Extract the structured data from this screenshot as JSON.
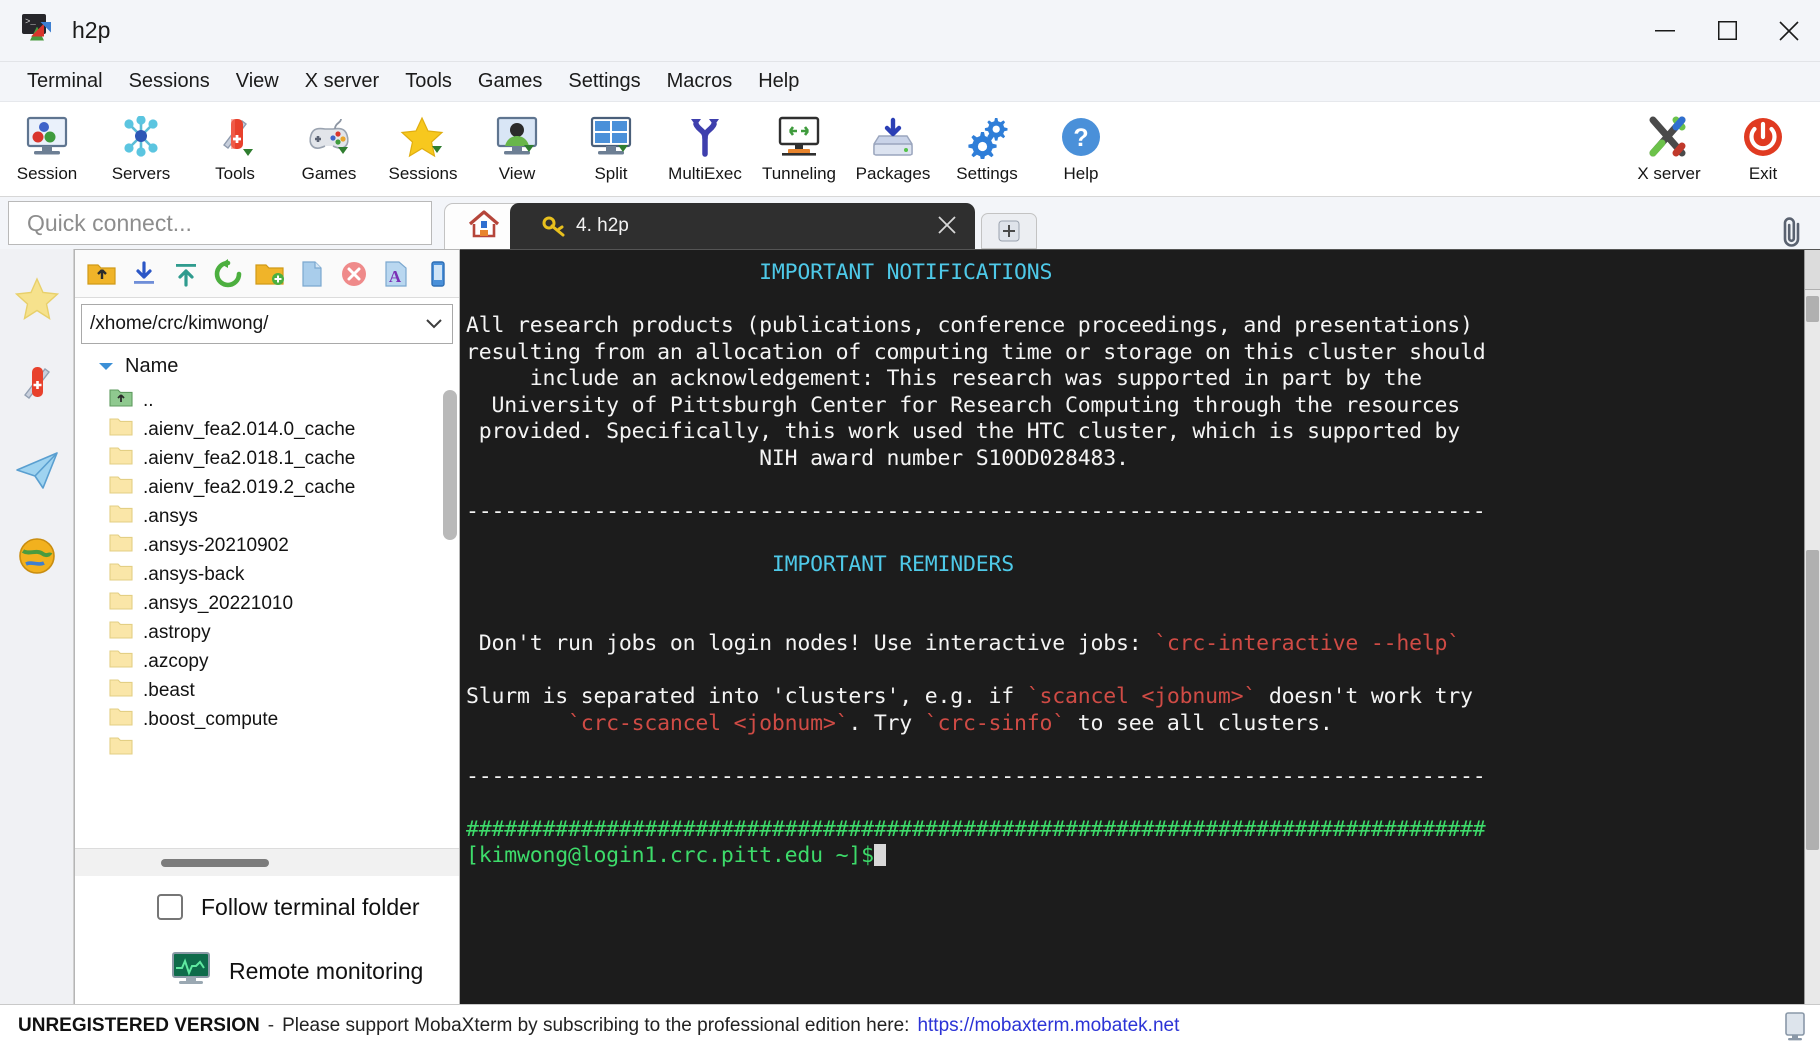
{
  "window": {
    "title": "h2p",
    "app_icon": "mobaxterm-icon",
    "minimize_label": "minimize",
    "maximize_label": "maximize",
    "close_label": "close"
  },
  "menubar": {
    "items": [
      {
        "label": "Terminal",
        "name": "menu-terminal"
      },
      {
        "label": "Sessions",
        "name": "menu-sessions"
      },
      {
        "label": "View",
        "name": "menu-view"
      },
      {
        "label": "X server",
        "name": "menu-x-server"
      },
      {
        "label": "Tools",
        "name": "menu-tools"
      },
      {
        "label": "Games",
        "name": "menu-games"
      },
      {
        "label": "Settings",
        "name": "menu-settings"
      },
      {
        "label": "Macros",
        "name": "menu-macros"
      },
      {
        "label": "Help",
        "name": "menu-help"
      }
    ]
  },
  "toolbar": {
    "buttons": [
      {
        "label": "Session",
        "icon": "session-icon"
      },
      {
        "label": "Servers",
        "icon": "servers-icon"
      },
      {
        "label": "Tools",
        "icon": "tools-icon"
      },
      {
        "label": "Games",
        "icon": "games-icon"
      },
      {
        "label": "Sessions",
        "icon": "sessions-star-icon"
      },
      {
        "label": "View",
        "icon": "view-icon"
      },
      {
        "label": "Split",
        "icon": "split-icon"
      },
      {
        "label": "MultiExec",
        "icon": "multiexec-icon"
      },
      {
        "label": "Tunneling",
        "icon": "tunneling-icon"
      },
      {
        "label": "Packages",
        "icon": "packages-icon"
      },
      {
        "label": "Settings",
        "icon": "settings-gear-icon"
      },
      {
        "label": "Help",
        "icon": "help-icon"
      }
    ],
    "right_buttons": [
      {
        "label": "X server",
        "icon": "x-server-icon"
      },
      {
        "label": "Exit",
        "icon": "exit-power-icon"
      }
    ]
  },
  "quick_connect": {
    "placeholder": "Quick connect...",
    "value": ""
  },
  "tabs": {
    "home_tab_icon": "home-icon",
    "terminal_tab": {
      "label": "4. h2p",
      "icon": "key-icon",
      "close_glyph": "×"
    },
    "add_tab_glyph": "➕",
    "clip_icon": "paperclip-icon"
  },
  "sidebar_rail": {
    "items": [
      {
        "name": "sidebar-sessions-star",
        "icon": "star-icon"
      },
      {
        "name": "sidebar-tools",
        "icon": "tools-icon"
      },
      {
        "name": "sidebar-macros",
        "icon": "paper-plane-icon"
      },
      {
        "name": "sidebar-sftp-globe",
        "icon": "globe-icon"
      }
    ]
  },
  "sftp": {
    "toolbar_icons": [
      {
        "name": "go-up-folder-button",
        "icon": "folder-up-icon"
      },
      {
        "name": "download-button",
        "icon": "download-arrow-icon"
      },
      {
        "name": "upload-button",
        "icon": "upload-arrow-icon"
      },
      {
        "name": "refresh-button",
        "icon": "refresh-icon"
      },
      {
        "name": "new-folder-button",
        "icon": "new-folder-icon"
      },
      {
        "name": "new-file-button",
        "icon": "new-file-icon"
      },
      {
        "name": "delete-button",
        "icon": "delete-circle-icon"
      },
      {
        "name": "text-mode-button",
        "icon": "font-a-icon"
      },
      {
        "name": "panel-toggle-button",
        "icon": "panel-toggle-icon"
      }
    ],
    "path": "/xhome/crc/kimwong/",
    "path_caret_glyph": "⌄",
    "column_header": "Name",
    "sort_caret_glyph": "▼",
    "files": [
      {
        "name": "..",
        "type": "parent"
      },
      {
        "name": ".aienv_fea2.014.0_cache",
        "type": "folder"
      },
      {
        "name": ".aienv_fea2.018.1_cache",
        "type": "folder"
      },
      {
        "name": ".aienv_fea2.019.2_cache",
        "type": "folder"
      },
      {
        "name": ".ansys",
        "type": "folder"
      },
      {
        "name": ".ansys-20210902",
        "type": "folder"
      },
      {
        "name": ".ansys-back",
        "type": "folder"
      },
      {
        "name": ".ansys_20221010",
        "type": "folder"
      },
      {
        "name": ".astropy",
        "type": "folder"
      },
      {
        "name": ".azcopy",
        "type": "folder"
      },
      {
        "name": ".beast",
        "type": "folder"
      },
      {
        "name": ".boost_compute",
        "type": "folder"
      }
    ],
    "follow_terminal_folder": {
      "label": "Follow terminal folder",
      "checked": false
    },
    "remote_monitoring": {
      "label": "Remote monitoring",
      "icon": "monitor-graph-icon"
    }
  },
  "terminal": {
    "lines": [
      {
        "segments": [
          {
            "text": "                       ",
            "color": "white"
          },
          {
            "text": "IMPORTANT NOTIFICATIONS",
            "color": "cyan"
          }
        ]
      },
      {
        "segments": [
          {
            "text": "",
            "color": "white"
          }
        ]
      },
      {
        "segments": [
          {
            "text": "All research products (publications, conference proceedings, and presentations)",
            "color": "white"
          }
        ]
      },
      {
        "segments": [
          {
            "text": "resulting from an allocation of computing time or storage on this cluster should",
            "color": "white"
          }
        ]
      },
      {
        "segments": [
          {
            "text": "     include an acknowledgement: This research was supported in part by the",
            "color": "white"
          }
        ]
      },
      {
        "segments": [
          {
            "text": "  University of Pittsburgh Center for Research Computing through the resources",
            "color": "white"
          }
        ]
      },
      {
        "segments": [
          {
            "text": " provided. Specifically, this work used the HTC cluster, which is supported by",
            "color": "white"
          }
        ]
      },
      {
        "segments": [
          {
            "text": "                       NIH award number S10OD028483.",
            "color": "white"
          }
        ]
      },
      {
        "segments": [
          {
            "text": "",
            "color": "white"
          }
        ]
      },
      {
        "segments": [
          {
            "text": "--------------------------------------------------------------------------------",
            "color": "white"
          }
        ]
      },
      {
        "segments": [
          {
            "text": "",
            "color": "white"
          }
        ]
      },
      {
        "segments": [
          {
            "text": "                        ",
            "color": "white"
          },
          {
            "text": "IMPORTANT REMINDERS",
            "color": "cyan"
          }
        ]
      },
      {
        "segments": [
          {
            "text": "",
            "color": "white"
          }
        ]
      },
      {
        "segments": [
          {
            "text": "",
            "color": "white"
          }
        ]
      },
      {
        "segments": [
          {
            "text": " Don't run jobs on login nodes! Use interactive jobs: ",
            "color": "white"
          },
          {
            "text": "`crc-interactive --help`",
            "color": "red"
          }
        ]
      },
      {
        "segments": [
          {
            "text": "",
            "color": "white"
          }
        ]
      },
      {
        "segments": [
          {
            "text": "Slurm is separated into 'clusters', e.g. if ",
            "color": "white"
          },
          {
            "text": "`scancel <jobnum>`",
            "color": "red"
          },
          {
            "text": " doesn't work try",
            "color": "white"
          }
        ]
      },
      {
        "segments": [
          {
            "text": "        ",
            "color": "white"
          },
          {
            "text": "`crc-scancel <jobnum>`",
            "color": "red"
          },
          {
            "text": ". Try ",
            "color": "white"
          },
          {
            "text": "`crc-sinfo`",
            "color": "red"
          },
          {
            "text": " to see all clusters.",
            "color": "white"
          }
        ]
      },
      {
        "segments": [
          {
            "text": "",
            "color": "white"
          }
        ]
      },
      {
        "segments": [
          {
            "text": "--------------------------------------------------------------------------------",
            "color": "white"
          }
        ]
      },
      {
        "segments": [
          {
            "text": "",
            "color": "white"
          }
        ]
      },
      {
        "segments": [
          {
            "text": "################################################################################",
            "color": "green"
          }
        ]
      },
      {
        "segments": [
          {
            "text": "[kimwong@login1.crc.pitt.edu ~]$",
            "color": "green"
          }
        ],
        "cursor": true
      }
    ]
  },
  "statusbar": {
    "unregistered": "UNREGISTERED VERSION",
    "dash": "-",
    "message": "Please support MobaXterm by subscribing to the professional edition here:",
    "link": "https://mobaxterm.mobatek.net",
    "right_icon": "monitor-icon"
  },
  "colors": {
    "accent": "#3d7fd1",
    "terminal_bg": "#1c1c1c",
    "terminal_cyan": "#4ec9e8",
    "terminal_red": "#cf4b45",
    "terminal_green": "#3ddb6a",
    "link": "#2b33d6",
    "tab_active_bg": "#2f2f2f"
  }
}
